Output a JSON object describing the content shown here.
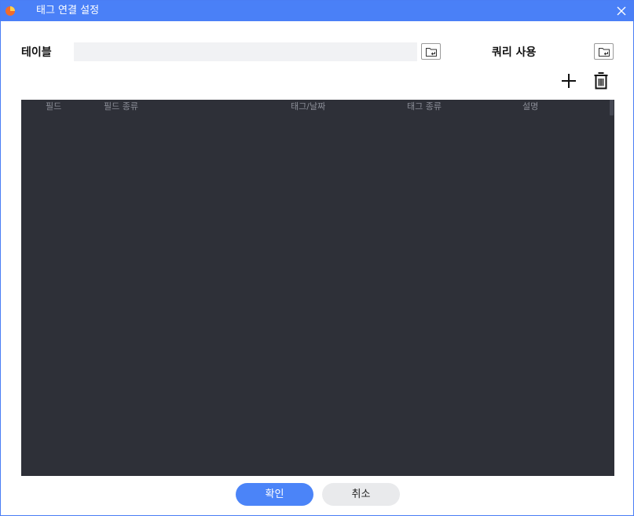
{
  "window": {
    "title": "태그 연결 설정",
    "accent_color": "#4a80f7",
    "logo_icon": "app-logo-icon",
    "close_icon": "close-icon"
  },
  "form": {
    "table_label": "테이블",
    "table_value": "",
    "table_browse_icon": "folder-import-icon",
    "query_label": "쿼리 사용",
    "query_browse_icon": "folder-import-icon"
  },
  "toolbar": {
    "add_icon": "plus-icon",
    "delete_icon": "trash-icon"
  },
  "grid": {
    "background": "#2e3038",
    "columns": [
      "필드",
      "필드 종류",
      "태그/날짜",
      "태그 종류",
      "설명"
    ],
    "rows": []
  },
  "footer": {
    "ok_label": "확인",
    "cancel_label": "취소"
  }
}
